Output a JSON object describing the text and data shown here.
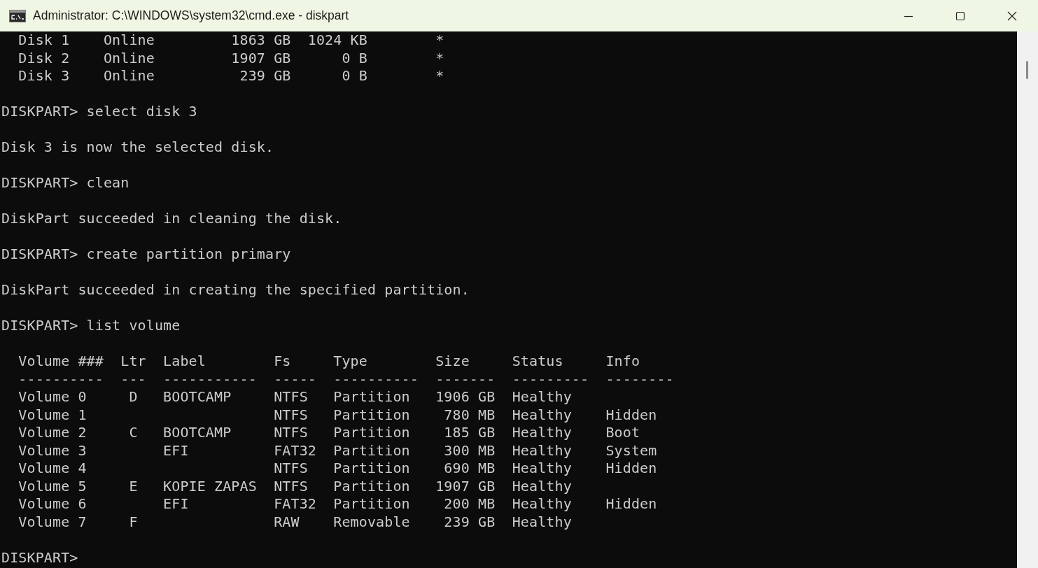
{
  "window": {
    "title": "Administrator: C:\\WINDOWS\\system32\\cmd.exe - diskpart"
  },
  "console": {
    "blocks": [
      [
        "  Disk 1    Online         1863 GB  1024 KB        *",
        "  Disk 2    Online         1907 GB      0 B        *",
        "  Disk 3    Online          239 GB      0 B        *"
      ],
      [
        "DISKPART> select disk 3"
      ],
      [
        "Disk 3 is now the selected disk."
      ],
      [
        "DISKPART> clean"
      ],
      [
        "DiskPart succeeded in cleaning the disk."
      ],
      [
        "DISKPART> create partition primary"
      ],
      [
        "DiskPart succeeded in creating the specified partition."
      ],
      [
        "DISKPART> list volume"
      ],
      [
        "  Volume ###  Ltr  Label        Fs     Type        Size     Status     Info",
        "  ----------  ---  -----------  -----  ----------  -------  ---------  --------",
        "  Volume 0     D   BOOTCAMP     NTFS   Partition   1906 GB  Healthy",
        "  Volume 1                      NTFS   Partition    780 MB  Healthy    Hidden",
        "  Volume 2     C   BOOTCAMP     NTFS   Partition    185 GB  Healthy    Boot",
        "  Volume 3         EFI          FAT32  Partition    300 MB  Healthy    System",
        "  Volume 4                      NTFS   Partition    690 MB  Healthy    Hidden",
        "  Volume 5     E   KOPIE ZAPAS  NTFS   Partition   1907 GB  Healthy",
        "  Volume 6         EFI          FAT32  Partition    200 MB  Healthy    Hidden",
        "  Volume 7     F                RAW    Removable    239 GB  Healthy"
      ],
      [
        "DISKPART>"
      ]
    ]
  }
}
